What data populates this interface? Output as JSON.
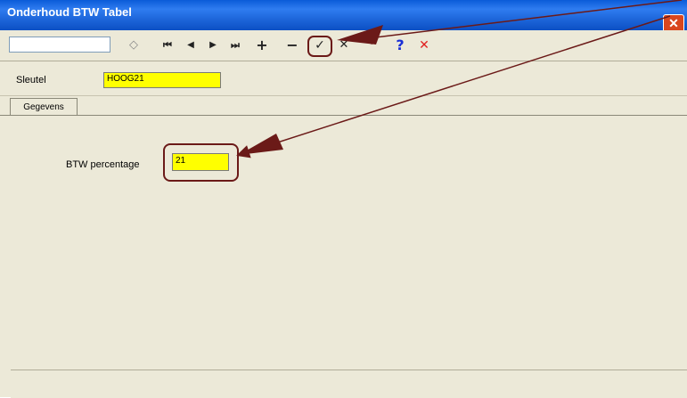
{
  "window": {
    "title": "Onderhoud BTW Tabel",
    "close_glyph": "✕"
  },
  "toolbar": {
    "buttons": [
      {
        "name": "clear-icon",
        "glyph": "◇"
      },
      {
        "name": "first-record-icon",
        "glyph": "⏮"
      },
      {
        "name": "prior-record-icon",
        "glyph": "◀"
      },
      {
        "name": "next-record-icon",
        "glyph": "▶"
      },
      {
        "name": "last-record-icon",
        "glyph": "⏭"
      },
      {
        "name": "insert-record-icon",
        "glyph": "+"
      },
      {
        "name": "delete-record-icon",
        "glyph": "−"
      },
      {
        "name": "post-checkmark-icon",
        "glyph": "✓"
      },
      {
        "name": "cancel-x-icon",
        "glyph": "✕"
      },
      {
        "name": "help-icon",
        "glyph": "?"
      },
      {
        "name": "close-red-x-icon",
        "glyph": "✕"
      }
    ]
  },
  "key": {
    "label": "Sleutel",
    "value": "HOOG21"
  },
  "tabs": [
    {
      "label": "Gegevens"
    }
  ],
  "form": {
    "btw_label": "BTW percentage",
    "btw_value": "21"
  },
  "colors": {
    "highlight_field": "#ffff00",
    "annotation": "#6b1a18"
  }
}
